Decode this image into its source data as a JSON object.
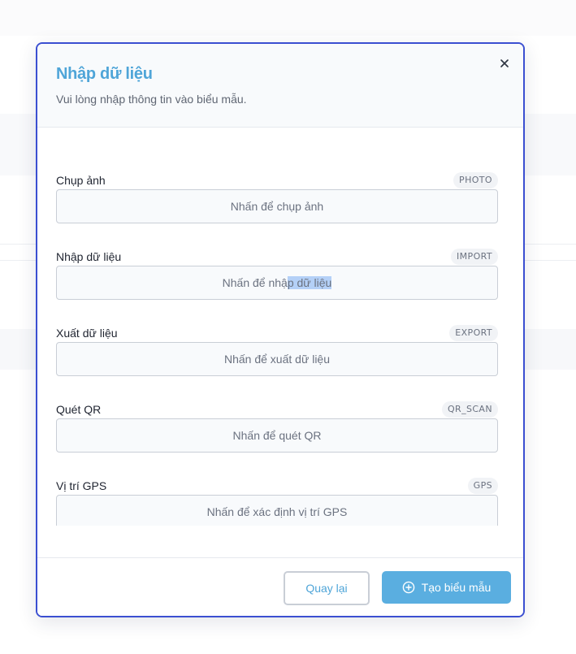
{
  "modal": {
    "title": "Nhập dữ liệu",
    "subtitle": "Vui lòng nhập thông tin vào biểu mẫu.",
    "close_icon": "close-icon"
  },
  "fields": [
    {
      "label": "Chụp ảnh",
      "tag": "PHOTO",
      "button": "Nhấn để chụp ảnh"
    },
    {
      "label": "Nhập dữ liệu",
      "tag": "IMPORT",
      "button_pre": "Nhấn để nhậ",
      "button_sel": "p dữ liệu"
    },
    {
      "label": "Xuất dữ liệu",
      "tag": "EXPORT",
      "button": "Nhấn để xuất dữ liệu"
    },
    {
      "label": "Quét QR",
      "tag": "QR_SCAN",
      "button": "Nhấn để quét QR"
    },
    {
      "label": "Vị trí GPS",
      "tag": "GPS",
      "button": "Nhấn để xác định vị trí GPS"
    }
  ],
  "footer": {
    "back_label": "Quay lại",
    "create_label": "Tạo biểu mẫu",
    "create_icon": "plus-circle-icon"
  },
  "colors": {
    "accent": "#4fa5d8",
    "primary_button": "#5aaee0",
    "modal_border": "#3b4fd1",
    "selection": "#b4d0f7"
  }
}
